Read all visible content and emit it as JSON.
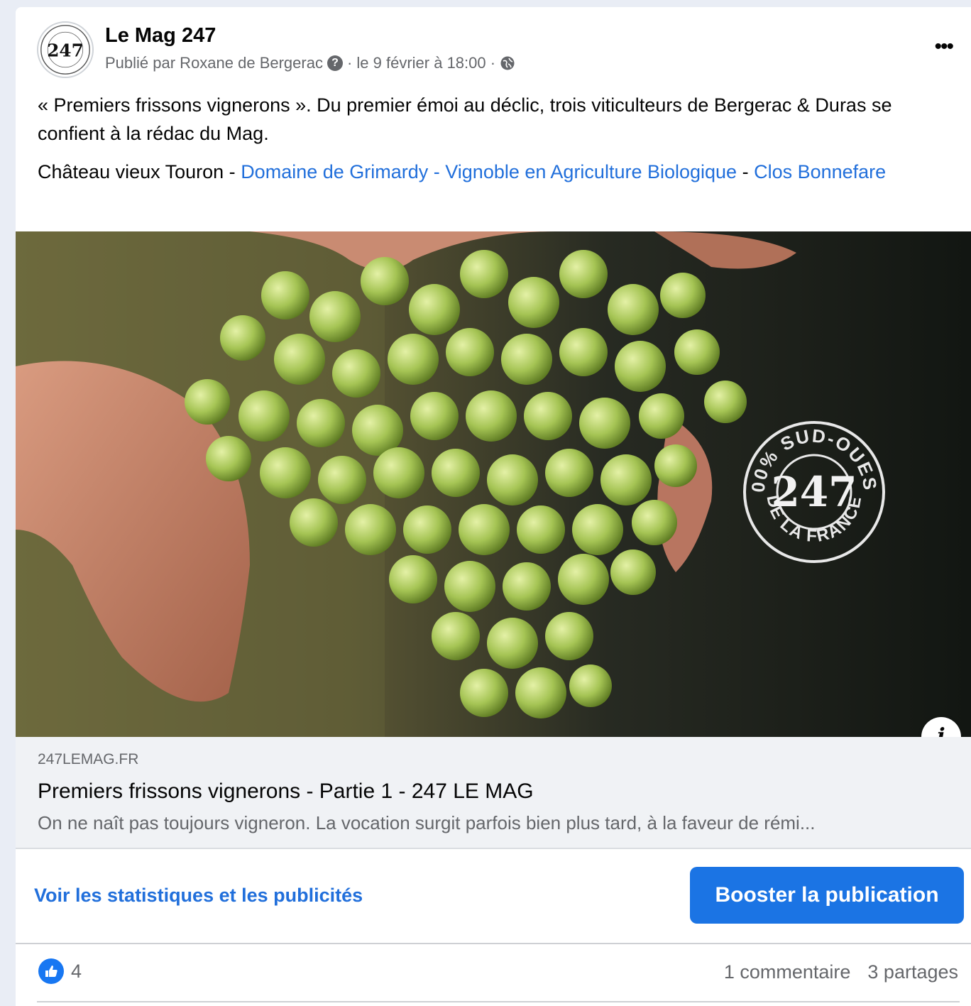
{
  "post": {
    "page_name": "Le Mag 247",
    "published_by": "Publié par Roxane de Bergerac",
    "date": "· le 9 février à 18:00 ·",
    "text_line1": "« Premiers frissons vignerons ».  Du premier émoi au déclic, trois viticulteurs de Bergerac & Duras se confient à la rédac du Mag.",
    "tags_prefix": "Château vieux Touron - ",
    "tag_link_1": "Domaine de Grimardy - Vignoble en Agriculture Biologique",
    "tags_separator": " - ",
    "tag_link_2": "Clos Bonnefare",
    "more_label": "•••"
  },
  "logo": {
    "top_text": "100% SUD-OUEST",
    "number": "247",
    "bottom_text": "DE LA FRANCE"
  },
  "image": {
    "description_icon": "grapes-photo",
    "info_label": "i"
  },
  "link_preview": {
    "domain": "247LEMAG.FR",
    "title": "Premiers frissons vignerons - Partie 1 - 247 LE MAG",
    "description": "On ne naît pas toujours vigneron. La vocation surgit parfois bien plus tard, à la faveur de rémi..."
  },
  "actions": {
    "stats_link": "Voir les statistiques et les publicités",
    "boost_label": "Booster la publication"
  },
  "engagement": {
    "likes": "4",
    "comments": "1 commentaire",
    "shares": "3 partages"
  },
  "colors": {
    "accent": "#1b74e4",
    "link": "#216fdb",
    "muted": "#65676b"
  }
}
